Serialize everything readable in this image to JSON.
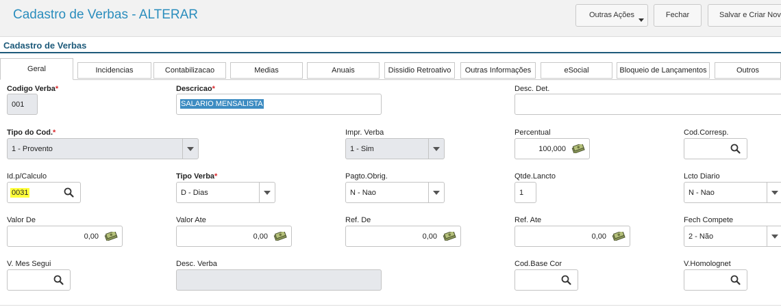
{
  "header": {
    "title": "Cadastro de Verbas - ALTERAR",
    "buttons": {
      "outras_acoes": "Outras Ações",
      "fechar": "Fechar",
      "salvar_criar": "Salvar e Criar Novo"
    }
  },
  "section": {
    "title": "Cadastro de Verbas"
  },
  "tabs": [
    "Geral",
    "Incidencias",
    "Contabilizacao",
    "Medias",
    "Anuais",
    "Dissidio Retroativo",
    "Outras Informações",
    "eSocial",
    "Bloqueio de Lançamentos",
    "Outros"
  ],
  "fields": {
    "codigo_verba": {
      "label": "Codigo Verba",
      "value": "001"
    },
    "descricao": {
      "label": "Descricao",
      "value": "SALARIO MENSALISTA"
    },
    "desc_det": {
      "label": "Desc. Det.",
      "value": ""
    },
    "tipo_cod": {
      "label": "Tipo do Cod.",
      "value": "1 - Provento"
    },
    "impr_verba": {
      "label": "Impr. Verba",
      "value": "1 - Sim"
    },
    "percentual": {
      "label": "Percentual",
      "value": "100,000"
    },
    "cod_corresp": {
      "label": "Cod.Corresp.",
      "value": ""
    },
    "id_calculo": {
      "label": "Id.p/Calculo",
      "value": "0031"
    },
    "tipo_verba": {
      "label": "Tipo Verba",
      "value": "D - Dias"
    },
    "pagto_obrig": {
      "label": "Pagto.Obrig.",
      "value": "N - Nao"
    },
    "qtde_lancto": {
      "label": "Qtde.Lancto",
      "value": "1"
    },
    "lcto_diario": {
      "label": "Lcto Diario",
      "value": "N - Nao"
    },
    "valor_de": {
      "label": "Valor De",
      "value": "0,00"
    },
    "valor_ate": {
      "label": "Valor Ate",
      "value": "0,00"
    },
    "ref_de": {
      "label": "Ref. De",
      "value": "0,00"
    },
    "ref_ate": {
      "label": "Ref. Ate",
      "value": "0,00"
    },
    "fech_compete": {
      "label": "Fech Compete",
      "value": "2 - Não"
    },
    "v_mes_segui": {
      "label": "V. Mes Segui",
      "value": ""
    },
    "desc_verba": {
      "label": "Desc. Verba",
      "value": ""
    },
    "cod_base_cor": {
      "label": "Cod.Base Cor",
      "value": ""
    },
    "v_homolognet": {
      "label": "V.Homolognet",
      "value": ""
    }
  },
  "required_marker": "*",
  "colors": {
    "title": "#2a8dbd",
    "section": "#1d5a7a",
    "required": "#d9262a",
    "highlight": "#ffff3a",
    "selection": "#3d8cc2"
  }
}
